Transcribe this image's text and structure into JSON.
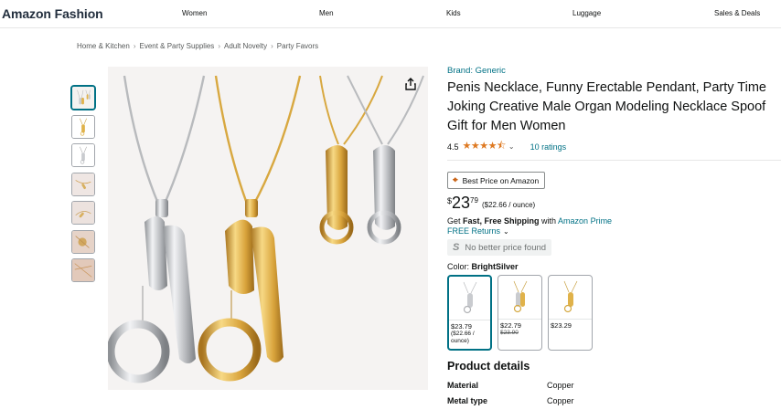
{
  "nav": {
    "brand": "Amazon Fashion",
    "links": [
      "Women",
      "Men",
      "Kids",
      "Luggage",
      "Sales & Deals"
    ]
  },
  "breadcrumb": [
    "Home & Kitchen",
    "Event & Party Supplies",
    "Adult Novelty",
    "Party Favors"
  ],
  "breadcrumb_sep": "›",
  "product": {
    "brand": "Brand: Generic",
    "title": "Penis Necklace, Funny Erectable Pendant, Party Time Joking Creative Male Organ Modeling Necklace Spoof Gift for Men Women",
    "rating": "4.5",
    "stars": "★★★★⯪",
    "ratings_count": "10 ratings",
    "best_price_label": "Best Price on Amazon",
    "price_symbol": "$",
    "price_whole": "23",
    "price_fraction": "79",
    "price_unit": "($22.66 / ounce)",
    "shipping_prefix": "Get ",
    "shipping_bold": "Fast, Free Shipping",
    "shipping_with": " with ",
    "shipping_prime": "Amazon Prime",
    "returns": "FREE Returns",
    "no_better": "No better price found",
    "no_better_icon": "S",
    "color_label": "Color: ",
    "color_value": "BrightSilver"
  },
  "swatches": [
    {
      "price": "$23.79",
      "sub": "($22.66 / ounce)",
      "strike": "",
      "selected": true,
      "metal": "silver"
    },
    {
      "price": "$22.79",
      "sub": "",
      "strike": "$23.90",
      "selected": false,
      "metal": "mixed"
    },
    {
      "price": "$23.29",
      "sub": "",
      "strike": "",
      "selected": false,
      "metal": "gold"
    }
  ],
  "details": {
    "title": "Product details",
    "rows": [
      {
        "key": "Material",
        "value": "Copper"
      },
      {
        "key": "Metal type",
        "value": "Copper"
      }
    ]
  },
  "colors": {
    "link": "#007185",
    "star": "#de7921",
    "gold": "#e6b44a",
    "silver": "#c9cbcf"
  },
  "icons": {
    "share": "share-icon",
    "chevron": "chevron-down-icon",
    "best_price": "price-tag-icon"
  }
}
